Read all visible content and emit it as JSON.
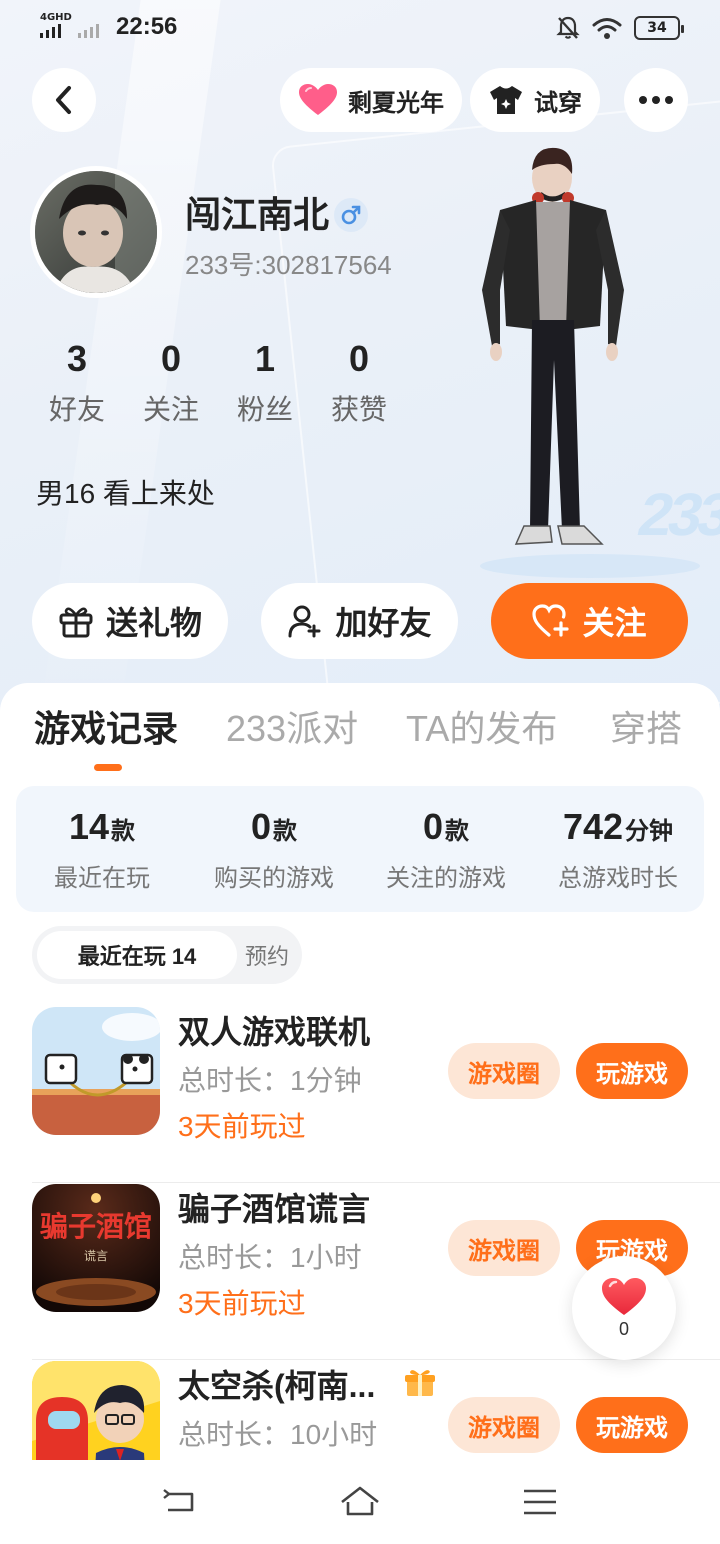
{
  "status_bar": {
    "network": "4GHD",
    "time": "22:56",
    "battery": "34"
  },
  "header": {
    "badge_label": "剩夏光年",
    "try_on_label": "试穿"
  },
  "profile": {
    "nickname": "闯江南北",
    "gender": "male",
    "user_id": "233号:302817564",
    "bio": "男16 看上来处",
    "stats": [
      {
        "value": "3",
        "label": "好友"
      },
      {
        "value": "0",
        "label": "关注"
      },
      {
        "value": "1",
        "label": "粉丝"
      },
      {
        "value": "0",
        "label": "获赞"
      }
    ],
    "stage_label": "233"
  },
  "actions": {
    "gift": "送礼物",
    "add_friend": "加好友",
    "follow": "关注"
  },
  "tabs": [
    "游戏记录",
    "233派对",
    "TA的发布",
    "穿搭"
  ],
  "summary": [
    {
      "value": "14",
      "unit": "款",
      "label": "最近在玩"
    },
    {
      "value": "0",
      "unit": "款",
      "label": "购买的游戏"
    },
    {
      "value": "0",
      "unit": "款",
      "label": "关注的游戏"
    },
    {
      "value": "742",
      "unit": "分钟",
      "label": "总游戏时长"
    }
  ],
  "subtabs": {
    "recent": "最近在玩 14",
    "reserve": "预约"
  },
  "games": [
    {
      "name": "双人游戏联机",
      "duration": "总时长：1分钟",
      "last_played": "3天前玩过",
      "circle_label": "游戏圈",
      "play_label": "玩游戏"
    },
    {
      "name": "骗子酒馆谎言",
      "duration": "总时长：1小时",
      "last_played": "3天前玩过",
      "circle_label": "游戏圈",
      "play_label": "玩游戏",
      "icon_text": "骗子酒馆",
      "icon_subtext": "谎言"
    },
    {
      "name": "太空杀(柯南...",
      "duration": "总时长：10小时",
      "last_played": "",
      "circle_label": "游戏圈",
      "play_label": "玩游戏"
    }
  ],
  "like": {
    "count": "0"
  },
  "colors": {
    "accent": "#ff6f1a",
    "accent_light": "#fde6d6",
    "summary_bg": "#f1f6fc"
  }
}
